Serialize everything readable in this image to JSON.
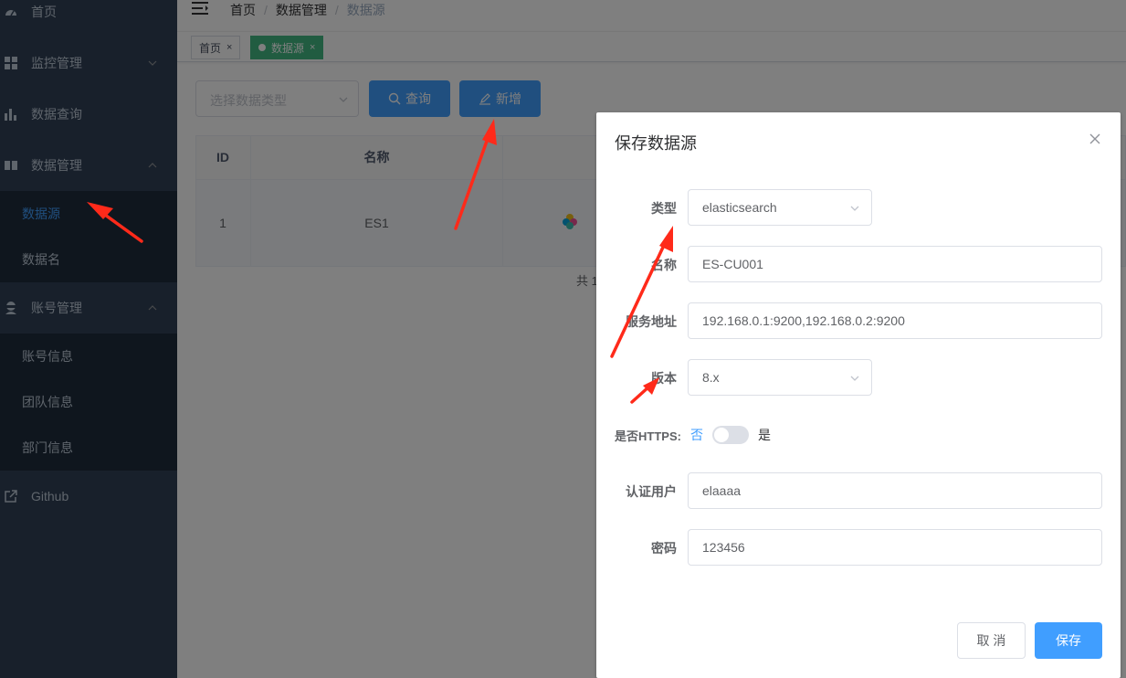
{
  "sidebar": {
    "items": [
      {
        "label": "首页",
        "icon": "dashboard-icon"
      },
      {
        "label": "监控管理",
        "icon": "grid-icon",
        "arrow": "chevron-down-icon"
      },
      {
        "label": "数据查询",
        "icon": "bar-chart-icon"
      },
      {
        "label": "数据管理",
        "icon": "database-icon",
        "arrow": "chevron-up-icon"
      },
      {
        "label": "账号管理",
        "icon": "user-icon",
        "arrow": "chevron-up-icon"
      },
      {
        "label": "Github",
        "icon": "external-link-icon"
      }
    ],
    "data_submenu": [
      "数据源",
      "数据名"
    ],
    "account_submenu": [
      "账号信息",
      "团队信息",
      "部门信息"
    ]
  },
  "breadcrumb": [
    "首页",
    "数据管理",
    "数据源"
  ],
  "tags": [
    {
      "label": "首页"
    },
    {
      "label": "数据源"
    }
  ],
  "toolbar": {
    "type_placeholder": "选择数据类型",
    "query_label": "查询",
    "add_label": "新增"
  },
  "table": {
    "headers": [
      "ID",
      "名称"
    ],
    "rows": [
      {
        "id": "1",
        "name": "ES1"
      }
    ],
    "pager_total": "共 1"
  },
  "dialog": {
    "title": "保存数据源",
    "fields": {
      "type_label": "类型",
      "type_value": "elasticsearch",
      "name_label": "名称",
      "name_value": "ES-CU001",
      "address_label": "服务地址",
      "address_value": "192.168.0.1:9200,192.168.0.2:9200",
      "version_label": "版本",
      "version_value": "8.x",
      "https_label": "是否HTTPS:",
      "https_off": "否",
      "https_on": "是",
      "user_label": "认证用户",
      "user_value": "elaaaa",
      "password_label": "密码",
      "password_value": "123456"
    },
    "cancel_label": "取 消",
    "save_label": "保存"
  },
  "colors": {
    "sidebar_bg": "#304156",
    "primary": "#409eff",
    "tag_active": "#42b983",
    "annotation_arrow": "#ff2a1a"
  }
}
